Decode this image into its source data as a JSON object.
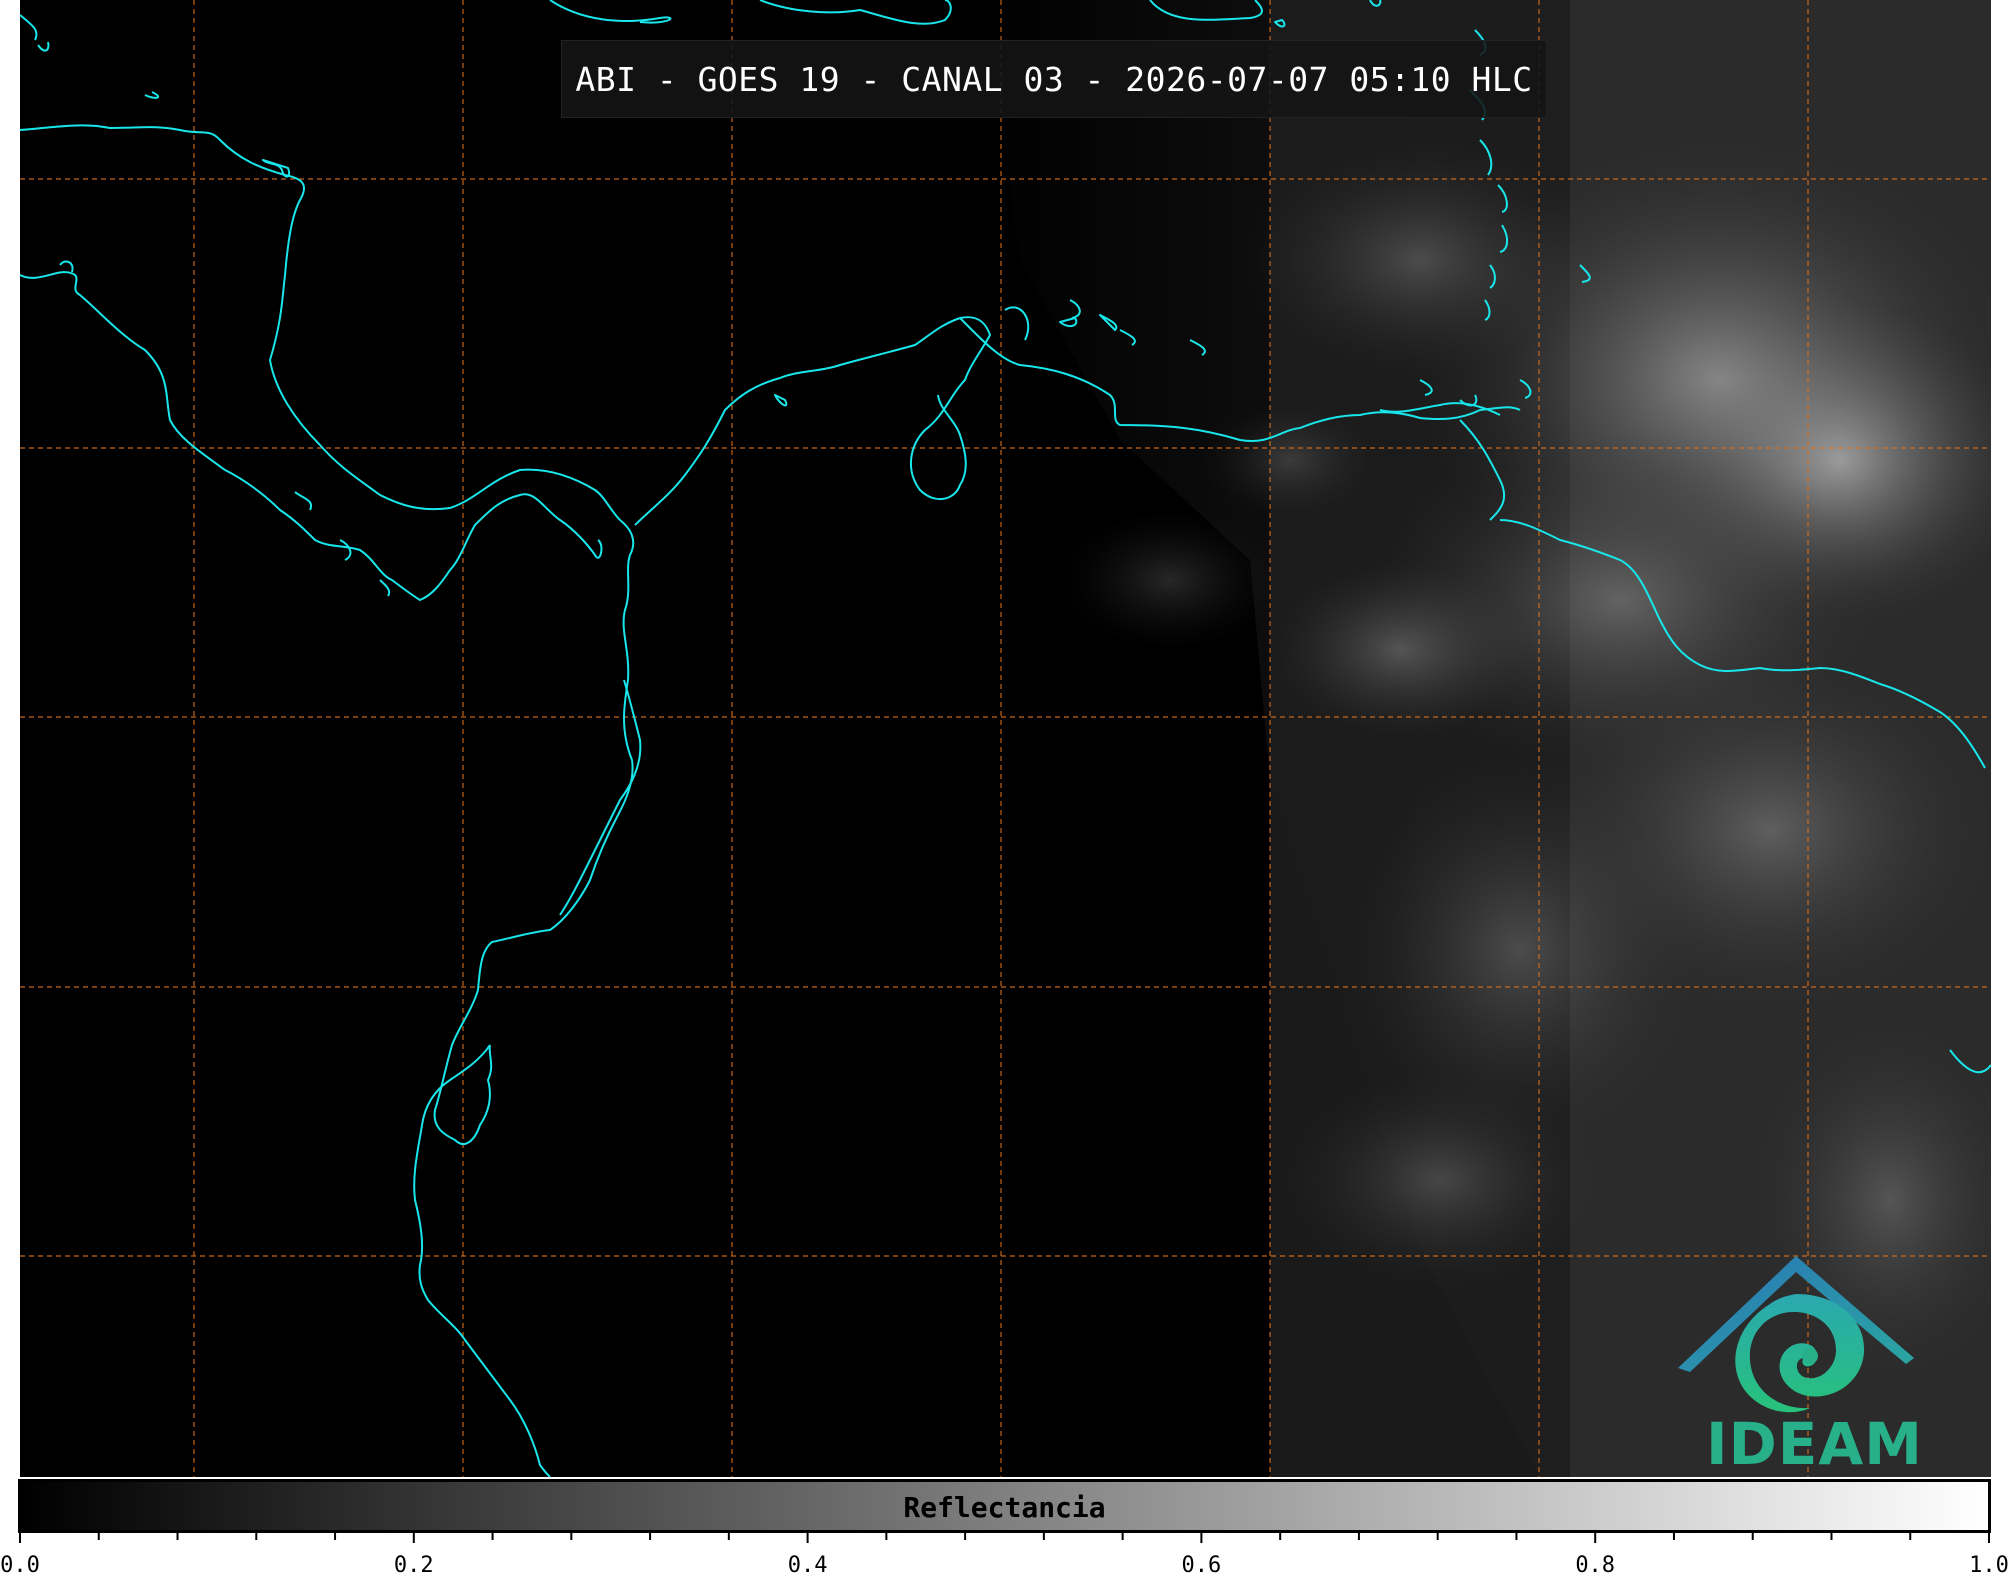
{
  "map": {
    "title": "ABI - GOES 19 - CANAL 03 - 2026-07-07 05:10 HLC",
    "coastline_color": "#19e6ea",
    "grid_color": "#d9701f",
    "background_color": "#000000"
  },
  "colorbar": {
    "label": "Reflectancia",
    "range": [
      0.0,
      1.0
    ],
    "colormap": "grayscale black-to-white",
    "tick_labels": [
      "0.0",
      "0.2",
      "0.4",
      "0.6",
      "0.8",
      "1.0"
    ],
    "minor_ticks_between": 4
  },
  "logo": {
    "text": "IDEAM",
    "text_color": "#27b089",
    "arch_color": "#2a75b8"
  }
}
